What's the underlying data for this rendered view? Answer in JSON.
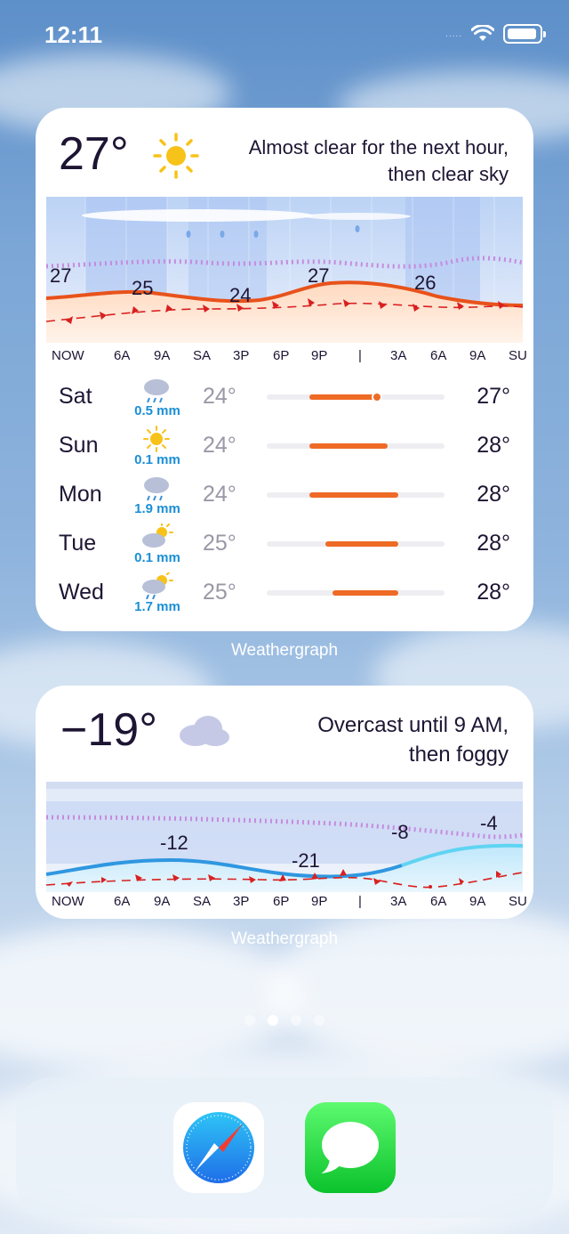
{
  "status_bar": {
    "time": "12:11",
    "signal": "....."
  },
  "widget1": {
    "temperature": "27°",
    "condition_icon": "sun-icon",
    "description_line1": "Almost clear for the next hour,",
    "description_line2": "then clear sky",
    "graph_labels": [
      "27",
      "25",
      "24",
      "27",
      "26"
    ],
    "axis": [
      "NOW",
      "6A",
      "9A",
      "SA",
      "3P",
      "6P",
      "9P",
      "|",
      "3A",
      "6A",
      "9A",
      "SU"
    ],
    "forecast": [
      {
        "day": "Sat",
        "icon": "rain-cloud-icon",
        "precip": "0.5 mm",
        "low": "24°",
        "high": "27°",
        "bar_start": 0.24,
        "bar_end": 0.63,
        "current_marker": 0.62
      },
      {
        "day": "Sun",
        "icon": "sun-icon",
        "precip": "0.1 mm",
        "low": "24°",
        "high": "28°",
        "bar_start": 0.24,
        "bar_end": 0.68
      },
      {
        "day": "Mon",
        "icon": "rain-cloud-icon",
        "precip": "1.9 mm",
        "low": "24°",
        "high": "28°",
        "bar_start": 0.24,
        "bar_end": 0.74
      },
      {
        "day": "Tue",
        "icon": "partly-sunny-cloud-icon",
        "precip": "0.1 mm",
        "low": "25°",
        "high": "28°",
        "bar_start": 0.33,
        "bar_end": 0.74
      },
      {
        "day": "Wed",
        "icon": "partly-sunny-rain-icon",
        "precip": "1.7 mm",
        "low": "25°",
        "high": "28°",
        "bar_start": 0.37,
        "bar_end": 0.74
      }
    ],
    "caption": "Weathergraph"
  },
  "widget2": {
    "temperature": "−19°",
    "condition_icon": "cloud-icon",
    "description_line1": "Overcast until 9 AM,",
    "description_line2": "then foggy",
    "graph_labels": [
      "-12",
      "-21",
      "-8",
      "-4"
    ],
    "axis": [
      "NOW",
      "6A",
      "9A",
      "SA",
      "3P",
      "6P",
      "9P",
      "|",
      "3A",
      "6A",
      "9A",
      "SU"
    ],
    "caption": "Weathergraph"
  },
  "page_indicator": {
    "count": 4,
    "active": 1
  },
  "dock": {
    "apps": [
      "Safari",
      "Messages"
    ]
  },
  "colors": {
    "temp_line_warm": "#e8521b",
    "temp_line_cold": "#2f97e0",
    "range_bar": "#ee6a25",
    "precip_text": "#1a8fd6",
    "wind_arrow": "#d82020",
    "accent_sun": "#f7c21a"
  }
}
